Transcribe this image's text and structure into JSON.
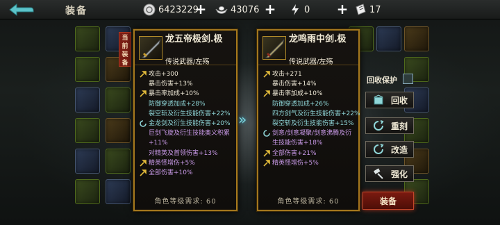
{
  "topbar": {
    "title": "装备",
    "resources": [
      {
        "icon": "silver-coin-icon",
        "value": "6423229"
      },
      {
        "icon": "ingot-icon",
        "value": "43076"
      },
      {
        "icon": "lightning-icon",
        "value": "0"
      },
      {
        "icon": "ticket-icon",
        "value": "17"
      }
    ]
  },
  "equipped_tag": "当前装备",
  "left_item": {
    "name": "龙五帝极剑.极",
    "type": "传说武器/左殇",
    "stats": [
      {
        "text": "攻击+300",
        "color": "white",
        "mark": "wrench"
      },
      {
        "text": "暴击伤害+13%",
        "color": "white",
        "mark": "none"
      },
      {
        "text": "暴击率加成+10%",
        "color": "white",
        "mark": "wrench"
      },
      {
        "text": "防御穿透加成+28%",
        "color": "cyan",
        "mark": "none"
      },
      {
        "text": "裂空斩及衍生技能伤害+22%",
        "color": "cyan",
        "mark": "none"
      },
      {
        "text": "金龙剑及衍生技能伤害+20%",
        "color": "cyan",
        "mark": "swirl"
      },
      {
        "text": "巨剑飞旋及衍生技能奥义积累+11%",
        "color": "purple",
        "mark": "none"
      },
      {
        "text": "对精英及首领伤害+13%",
        "color": "purple",
        "mark": "none"
      },
      {
        "text": "精英怪增伤+5%",
        "color": "purple",
        "mark": "wrench"
      },
      {
        "text": "全部伤害+10%",
        "color": "purple",
        "mark": "wrench"
      }
    ],
    "level_req": "角色等级需求: 60"
  },
  "right_item": {
    "name": "龙鸣雨中剑.极",
    "type": "传说武器/左殇",
    "stats": [
      {
        "text": "攻击+271",
        "color": "white",
        "mark": "wrench"
      },
      {
        "text": "暴击伤害+14%",
        "color": "white",
        "mark": "none"
      },
      {
        "text": "暴击率加成+10%",
        "color": "white",
        "mark": "wrench"
      },
      {
        "text": "防御穿透加成+26%",
        "color": "cyan",
        "mark": "none"
      },
      {
        "text": "四方剑气及衍生技能伤害+22%",
        "color": "cyan",
        "mark": "none"
      },
      {
        "text": "裂空斩及衍生技能伤害+15%",
        "color": "cyan",
        "mark": "none"
      },
      {
        "text": "剑意/剑意凝聚/剑意沸腾及衍生技能伤害+18%",
        "color": "purple",
        "mark": "swirl"
      },
      {
        "text": "全部伤害+21%",
        "color": "purple",
        "mark": "wrench"
      },
      {
        "text": "精英怪增伤+5%",
        "color": "purple",
        "mark": "wrench"
      }
    ],
    "level_req": "角色等级需求: 60"
  },
  "actions": {
    "recycle_protect": "回收保护",
    "recycle": "回收",
    "reforge": "重刻",
    "modify": "改造",
    "enhance": "强化",
    "equip": "装备"
  },
  "colors": {
    "gold_frame": "#a4781e",
    "equip_red": "#7a1a10",
    "cyan": "#8fd6d8",
    "purple": "#c99ae8"
  }
}
